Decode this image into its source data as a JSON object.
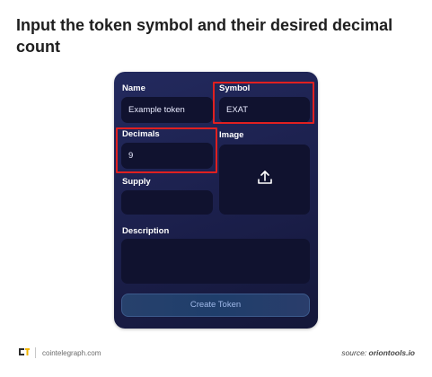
{
  "headline": "Input the token symbol and their desired decimal count",
  "form": {
    "name_label": "Name",
    "name_value": "Example token",
    "symbol_label": "Symbol",
    "symbol_value": "EXAT",
    "decimals_label": "Decimals",
    "decimals_value": "9",
    "image_label": "Image",
    "image_icon": "upload-icon",
    "supply_label": "Supply",
    "supply_value": "",
    "description_label": "Description",
    "description_value": "",
    "submit_label": "Create Token"
  },
  "footer": {
    "brand": "cointelegraph.com",
    "source_prefix": "source:",
    "source_name": "oriontools.io"
  },
  "colors": {
    "panel": "#1b1f4b",
    "field": "#10122f",
    "highlight": "#e02020",
    "button_text": "#9fb8e8"
  }
}
